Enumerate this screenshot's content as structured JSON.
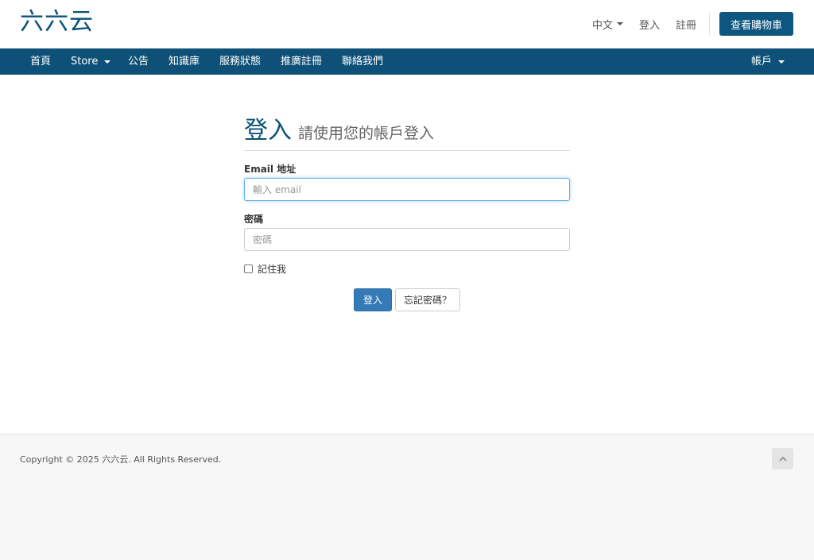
{
  "header": {
    "logo": "六六云",
    "language": "中文",
    "login": "登入",
    "register": "註冊",
    "cart": "查看購物車"
  },
  "nav": {
    "items": [
      "首頁",
      "Store",
      "公告",
      "知識庫",
      "服務狀態",
      "推廣註冊",
      "聯絡我們"
    ],
    "account": "帳戶"
  },
  "login": {
    "title": "登入",
    "subtitle": "請使用您的帳戶登入",
    "email_label": "Email 地址",
    "email_placeholder": "輸入 email",
    "password_label": "密碼",
    "password_placeholder": "密碼",
    "remember": "記住我",
    "submit": "登入",
    "forgot": "忘記密碼？"
  },
  "footer": {
    "copyright": "Copyright © 2025 六六云. All Rights Reserved."
  },
  "icons": {
    "back_to_top": "chevron-up-icon"
  }
}
